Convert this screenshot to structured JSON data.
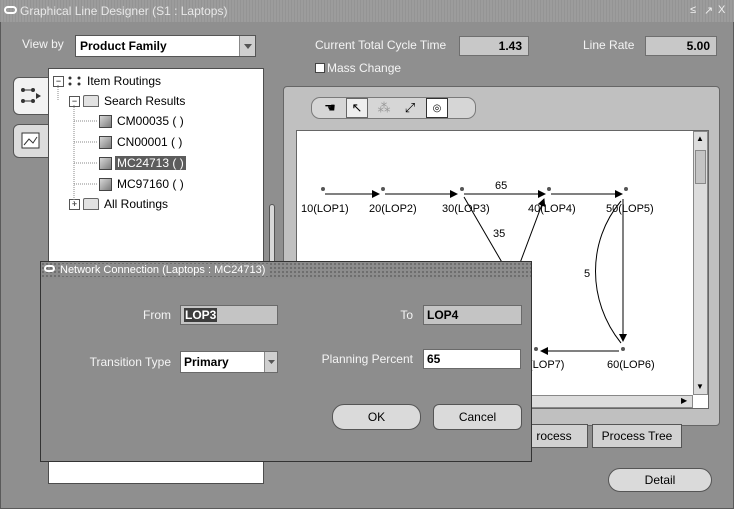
{
  "window": {
    "title": "Graphical Line Designer (S1 : Laptops)",
    "controls": [
      "≤",
      "↗",
      "X"
    ]
  },
  "view_by": {
    "label": "View by",
    "value": "Product Family"
  },
  "cycle_time": {
    "label": "Current Total Cycle Time",
    "value": "1.43"
  },
  "line_rate": {
    "label": "Line Rate",
    "value": "5.00"
  },
  "mass_change": {
    "label": "Mass Change",
    "checked": false
  },
  "tree": {
    "root": "Item Routings",
    "search_results": "Search Results",
    "items": [
      "CM00035 ( )",
      "CN00001 ( )",
      "MC24713 ( )",
      "MC97160 ( )"
    ],
    "selected_index": 2,
    "all_routings": "All Routings"
  },
  "network": {
    "nodes": [
      "10(LOP1)",
      "20(LOP2)",
      "30(LOP3)",
      "40(LOP4)",
      "50(LOP5)",
      "60(LOP6)",
      "(LOP7)"
    ],
    "edge_labels": [
      "65",
      "35",
      "5"
    ]
  },
  "tabs": {
    "process": "rocess",
    "process_tree": "Process Tree"
  },
  "detail_button": "Detail",
  "dialog": {
    "title": "Network Connection (Laptops : MC24713)",
    "from_label": "From",
    "from_value": "LOP3",
    "to_label": "To",
    "to_value": "LOP4",
    "transition_label": "Transition Type",
    "transition_value": "Primary",
    "planning_label": "Planning Percent",
    "planning_value": "65",
    "ok": "OK",
    "cancel": "Cancel"
  }
}
